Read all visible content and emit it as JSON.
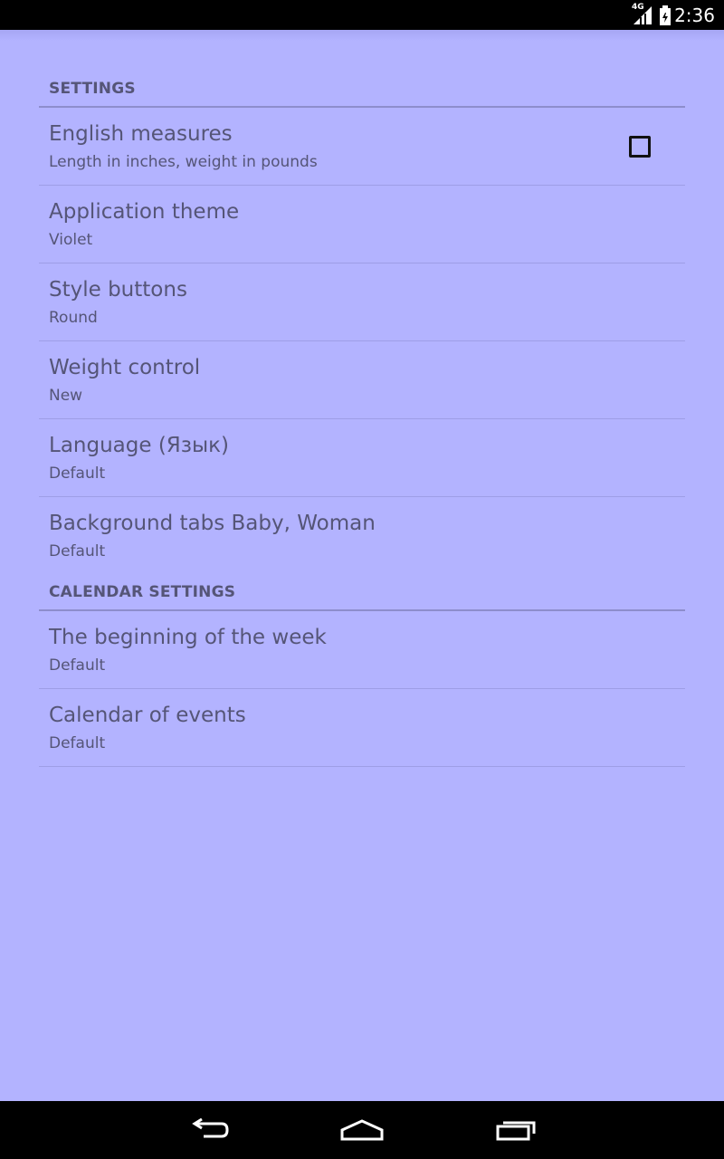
{
  "status_bar": {
    "network": "4G",
    "time": "2:36"
  },
  "sections": [
    {
      "title": "SETTINGS",
      "items": [
        {
          "title": "English measures",
          "summary": "Length in inches, weight in pounds",
          "checked": false
        },
        {
          "title": "Application theme",
          "summary": "Violet"
        },
        {
          "title": "Style buttons",
          "summary": "Round"
        },
        {
          "title": "Weight control",
          "summary": "New"
        },
        {
          "title": "Language (Язык)",
          "summary": "Default"
        },
        {
          "title": "Background tabs Baby, Woman",
          "summary": "Default"
        }
      ]
    },
    {
      "title": "CALENDAR SETTINGS",
      "items": [
        {
          "title": "The beginning of the week",
          "summary": "Default"
        },
        {
          "title": "Calendar of events",
          "summary": "Default"
        }
      ]
    }
  ],
  "nav_bar": {
    "back": "back-icon",
    "home": "home-icon",
    "recents": "recents-icon"
  },
  "colors": {
    "background": "#b3b3ff",
    "text": "#555577",
    "divider": "#8d8dcc"
  }
}
